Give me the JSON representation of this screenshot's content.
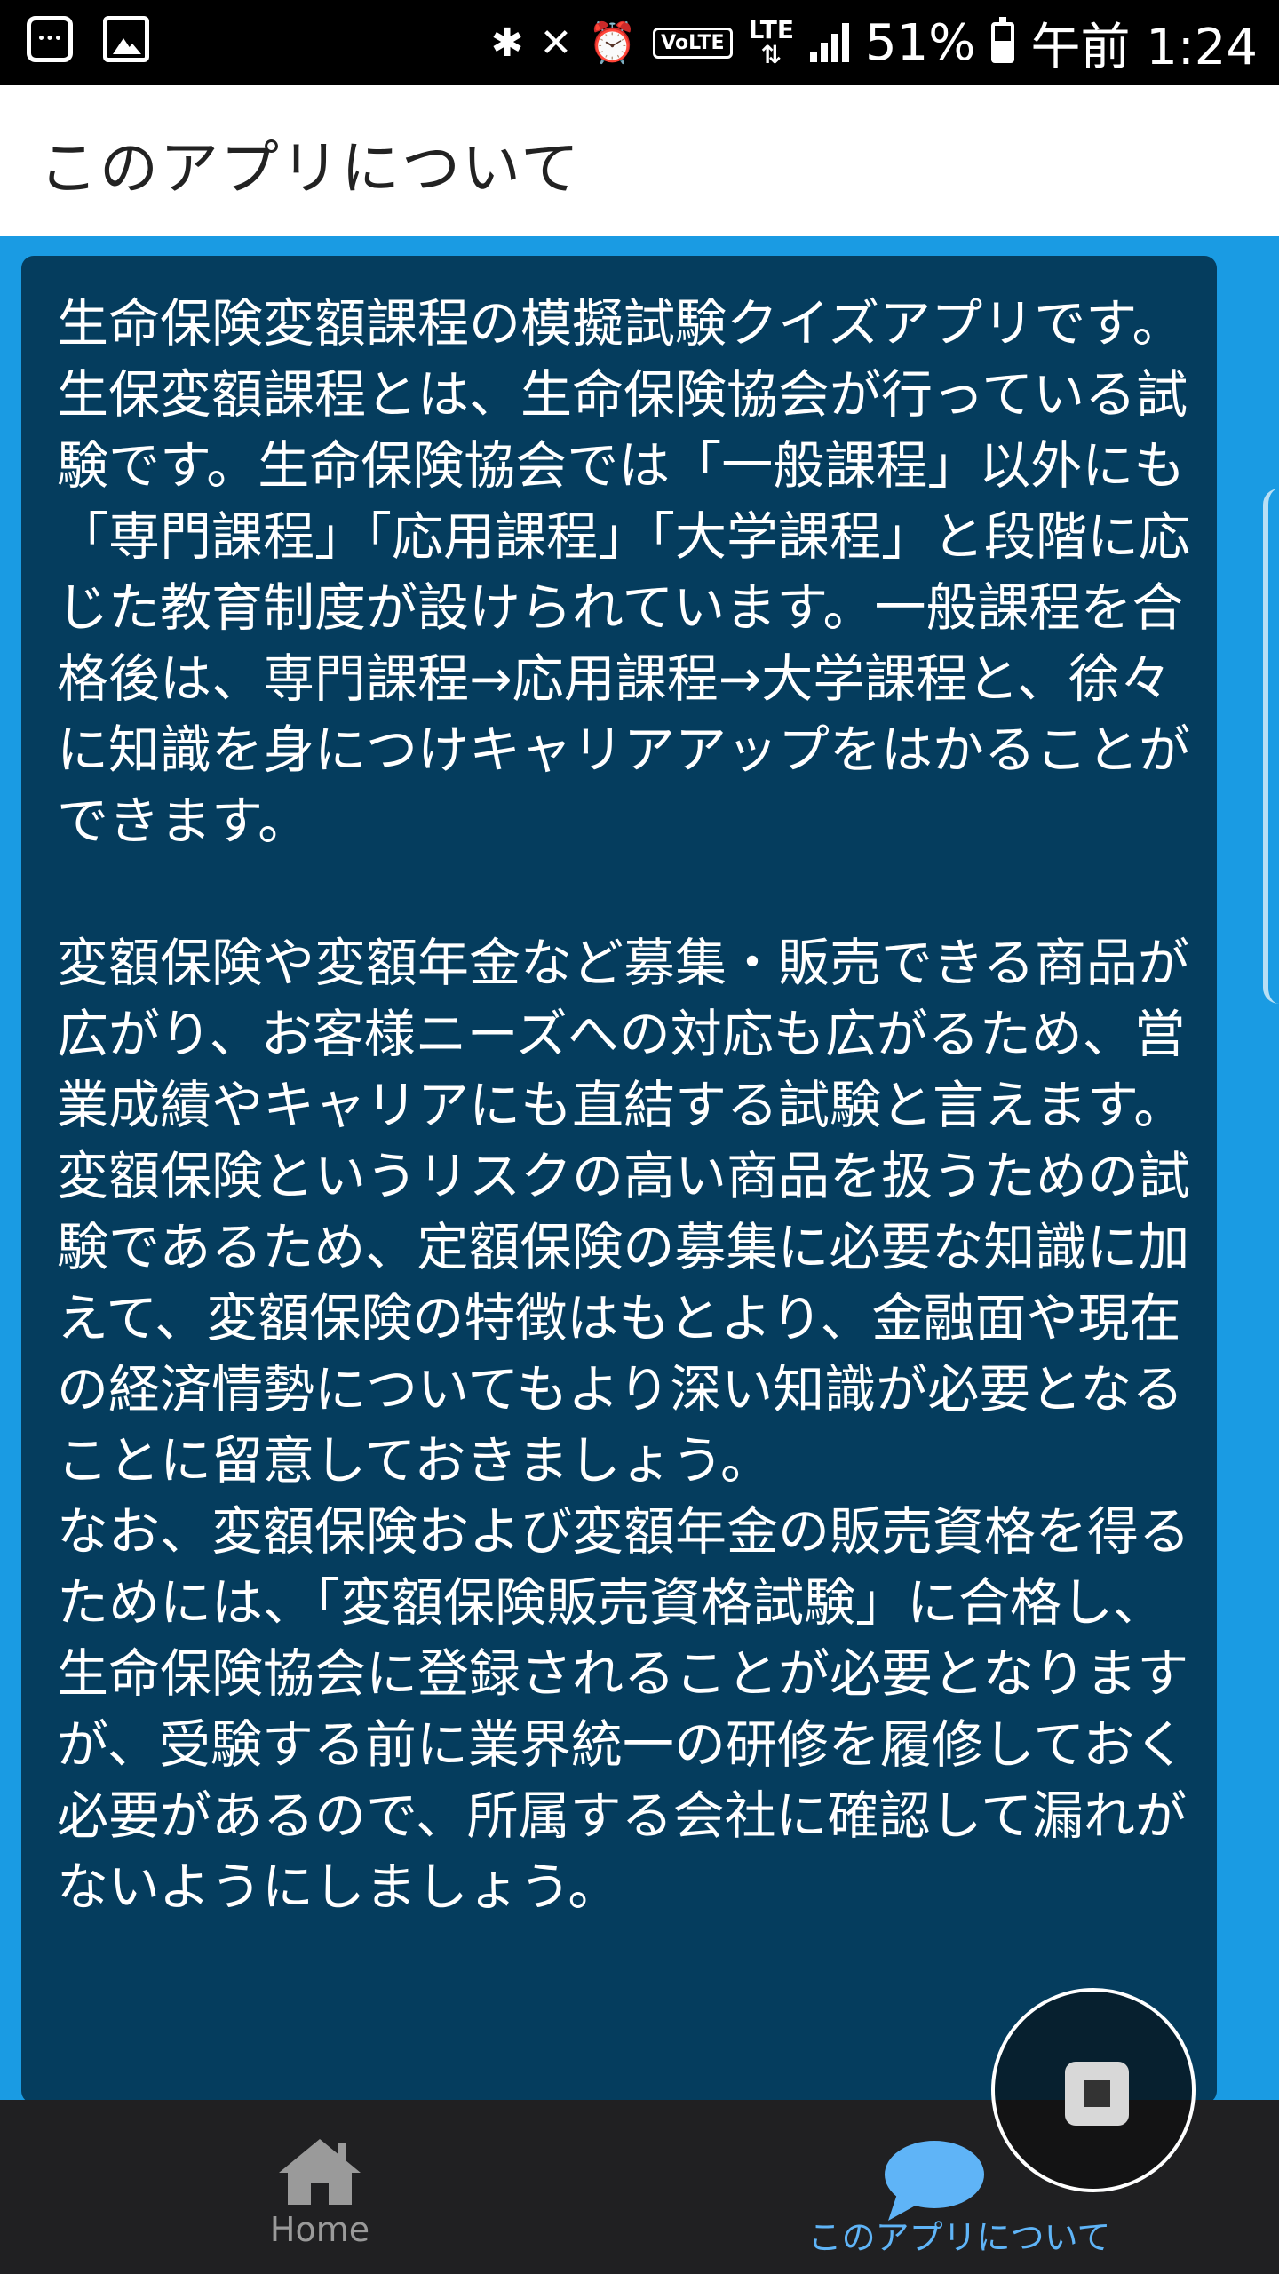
{
  "status_bar": {
    "battery": "51%",
    "time": "午前 1:24",
    "network": "LTE",
    "volte": "VoLTE"
  },
  "app_bar": {
    "title": "このアプリについて"
  },
  "content": {
    "text": "生命保険変額課程の模擬試験クイズアプリです。\n生保変額課程とは、生命保険協会が行っている試験です。生命保険協会では「一般課程」以外にも「専門課程」「応用課程」「大学課程」と段階に応じた教育制度が設けられています。一般課程を合格後は、専門課程→応用課程→大学課程と、徐々に知識を身につけキャリアアップをはかることができます。\n\n変額保険や変額年金など募集・販売できる商品が広がり、お客様ニーズへの対応も広がるため、営業成績やキャリアにも直結する試験と言えます。変額保険というリスクの高い商品を扱うための試験であるため、定額保険の募集に必要な知識に加えて、変額保険の特徴はもとより、金融面や現在の経済情勢についてもより深い知識が必要となることに留意しておきましょう。\nなお、変額保険および変額年金の販売資格を得るためには、「変額保険販売資格試験」に合格し、生命保険協会に登録されることが必要となりますが、受験する前に業界統一の研修を履修しておく必要があるので、所属する会社に確認して漏れがないようにしましょう。"
  },
  "bottom_nav": {
    "items": [
      {
        "label": "Home",
        "icon": "home-icon",
        "active": false
      },
      {
        "label": "このアプリについて",
        "icon": "chat-bubble-icon",
        "active": true
      }
    ]
  },
  "colors": {
    "background": "#1a9be3",
    "card": "#053d5e",
    "nav_bg": "#202022",
    "active": "#5fb4f7"
  }
}
